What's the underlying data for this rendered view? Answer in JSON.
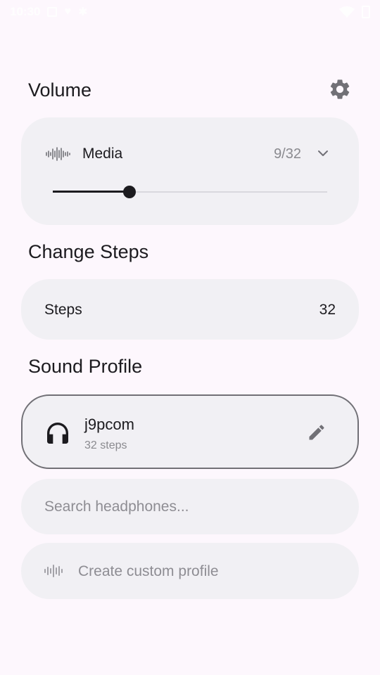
{
  "status_bar": {
    "time": "10:30"
  },
  "volume": {
    "title": "Volume",
    "stream_label": "Media",
    "level_text": "9/32",
    "level_fraction": 0.28
  },
  "change_steps": {
    "title": "Change Steps",
    "steps_label": "Steps",
    "steps_value": "32"
  },
  "sound_profile": {
    "title": "Sound Profile",
    "profile_name": "j9pcom",
    "profile_steps": "32 steps",
    "search_placeholder": "Search headphones...",
    "create_label": "Create custom profile"
  },
  "icons": {
    "settings": "gear-icon",
    "media": "sound-wave-icon",
    "expand": "chevron-down-icon",
    "headphones": "headphones-icon",
    "edit": "pencil-icon",
    "create": "sound-wave-icon"
  },
  "colors": {
    "background": "#fdf7fd",
    "card": "#f1f0f4",
    "text": "#1c1b1f",
    "muted": "#8a8a8f",
    "icon": "#717076"
  }
}
